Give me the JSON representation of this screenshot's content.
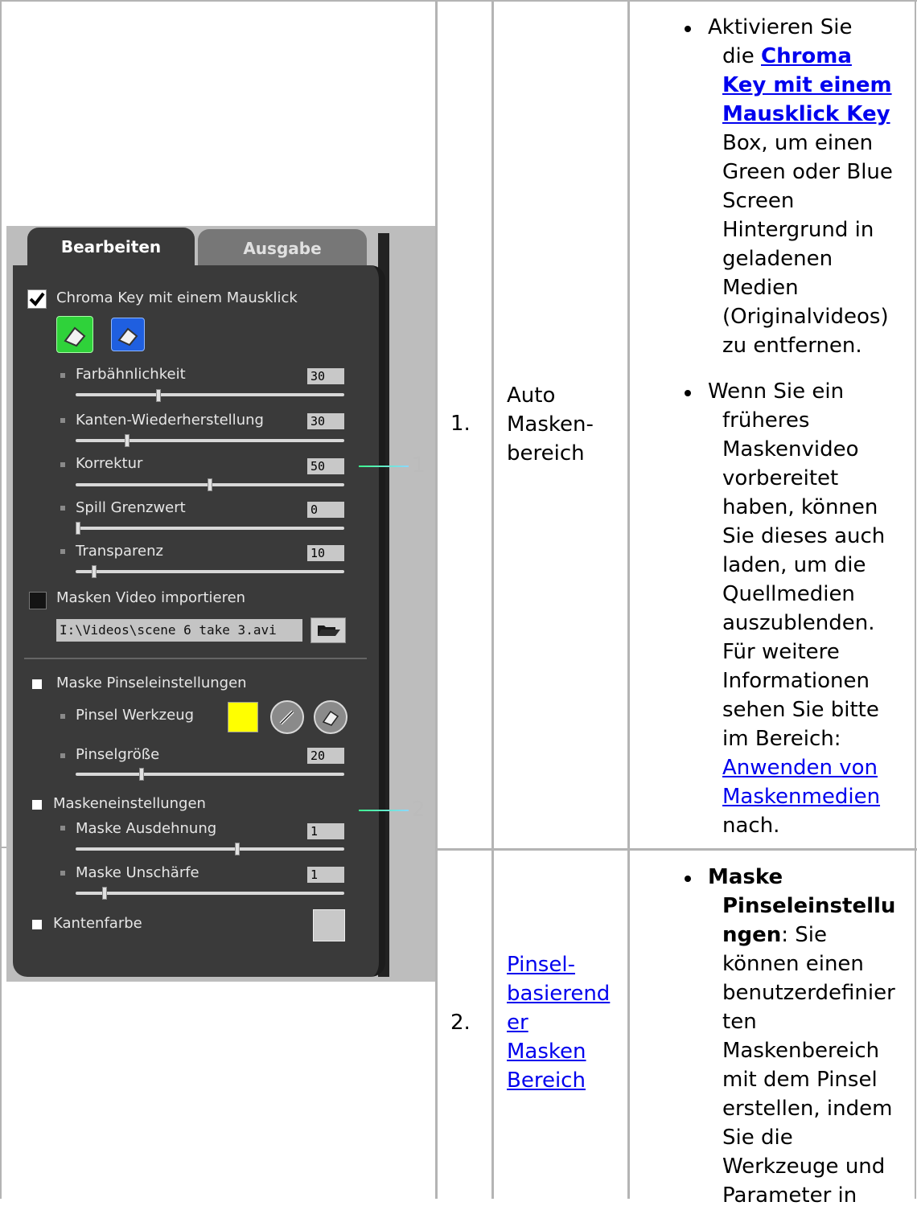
{
  "panel": {
    "tab_active": "Bearbeiten",
    "tab_inactive": "Ausgabe",
    "chroma_key": "Chroma Key mit einem Mausklick",
    "sliders": [
      {
        "label": "Farbähnlichkeit",
        "value": "30"
      },
      {
        "label": "Kanten-Wiederherstellung",
        "value": "30"
      },
      {
        "label": "Korrektur",
        "value": "50"
      },
      {
        "label": "Spill Grenzwert",
        "value": "0"
      },
      {
        "label": "Transparenz",
        "value": "10"
      }
    ],
    "mask_video": "Masken Video importieren",
    "file_path": "I:\\Videos\\scene 6 take 3.avi",
    "brush_settings": "Maske Pinseleinstellungen",
    "brush_tool": "Pinsel Werkzeug",
    "brush_size_label": "Pinselgröße",
    "brush_size_value": "20",
    "mask_settings": "Maskeneinstellungen",
    "mask_expand_label": "Maske Ausdehnung",
    "mask_expand_value": "1",
    "mask_blur_label": "Maske Unschärfe",
    "mask_blur_value": "1",
    "edge_color": "Kantenfarbe",
    "callout_1": "1",
    "callout_2": "2"
  },
  "rows": [
    {
      "num": "1.",
      "name_lines": [
        "Auto",
        "Masken-",
        "bereich"
      ],
      "bullet1": {
        "pre": [
          "Aktivieren Sie",
          "die "
        ],
        "link_lines": [
          "Chroma",
          "Key mit einem",
          "Mausklick Key"
        ],
        "post": [
          "Box, um einen",
          "Green oder Blue",
          "Screen",
          "Hintergrund in",
          "geladenen",
          "Medien",
          "(Originalvideos)",
          "zu entfernen."
        ]
      },
      "bullet2": {
        "lines": [
          "Wenn Sie ein",
          "früheres",
          "Maskenvideo",
          "vorbereitet",
          "haben, können",
          "Sie dieses auch",
          "laden, um die",
          "Quellmedien",
          "auszublenden.",
          "Für weitere",
          "Informationen",
          "sehen Sie bitte",
          "im Bereich:"
        ],
        "link_lines": [
          "Anwenden von",
          "Maskenmedien"
        ],
        "tail": "nach."
      }
    },
    {
      "num": "2.",
      "name_link_lines": [
        "Pinsel-",
        "basierend",
        "er",
        "Masken",
        "Bereich"
      ],
      "bullet1": {
        "bold_lines": [
          "Maske",
          "Pinseleinstellu",
          "ngen"
        ],
        "rest_first": ": Sie",
        "lines": [
          "können einen",
          "benutzerdefinier",
          "ten",
          "Maskenbereich",
          "mit dem Pinsel",
          "erstellen, indem",
          "Sie die",
          "Werkzeuge und",
          "Parameter in"
        ]
      }
    }
  ]
}
